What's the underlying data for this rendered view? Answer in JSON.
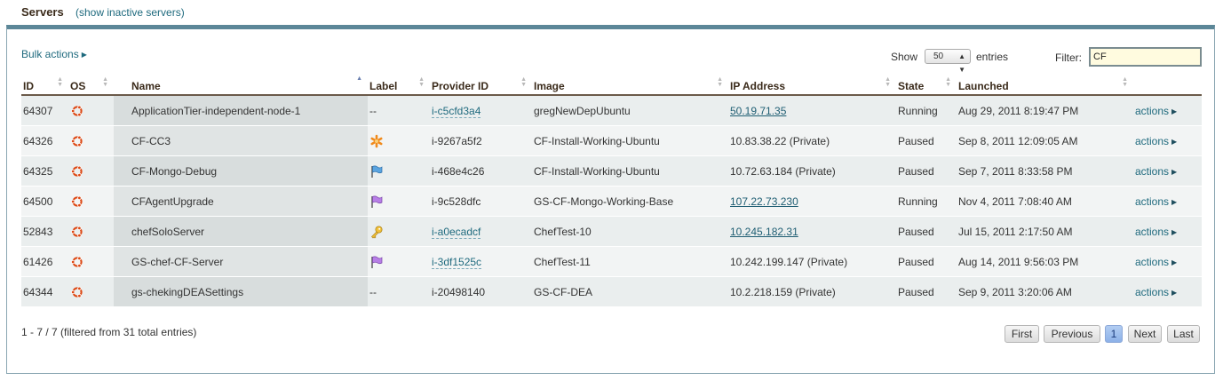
{
  "header": {
    "title": "Servers",
    "inactive_link": "(show inactive servers)"
  },
  "toolbar": {
    "bulk_actions": "Bulk actions",
    "show_label": "Show",
    "show_value": "50",
    "entries_label": "entries",
    "filter_label": "Filter:",
    "filter_value": "CF"
  },
  "table": {
    "columns": [
      "ID",
      "OS",
      "Name",
      "Label",
      "Provider ID",
      "Image",
      "IP Address",
      "State",
      "Launched"
    ],
    "sorted_column": "Name",
    "rows": [
      {
        "id": "64307",
        "os": "ubuntu-icon",
        "name": "ApplicationTier-independent-node-1",
        "label": "--",
        "label_icon": "",
        "provider_id": "i-c5cfd3a4",
        "provider_link": true,
        "image": "gregNewDepUbuntu",
        "ip": "50.19.71.35",
        "ip_link": true,
        "state": "Running",
        "launched": "Aug 29, 2011 8:19:47 PM",
        "actions": "actions"
      },
      {
        "id": "64326",
        "os": "ubuntu-icon",
        "name": "CF-CC3",
        "label": "",
        "label_icon": "orange-star",
        "provider_id": "i-9267a5f2",
        "provider_link": false,
        "image": "CF-Install-Working-Ubuntu",
        "ip": "10.83.38.22 (Private)",
        "ip_link": false,
        "state": "Paused",
        "launched": "Sep 8, 2011 12:09:05 AM",
        "actions": "actions"
      },
      {
        "id": "64325",
        "os": "ubuntu-icon",
        "name": "CF-Mongo-Debug",
        "label": "",
        "label_icon": "blue-flag",
        "provider_id": "i-468e4c26",
        "provider_link": false,
        "image": "CF-Install-Working-Ubuntu",
        "ip": "10.72.63.184 (Private)",
        "ip_link": false,
        "state": "Paused",
        "launched": "Sep 7, 2011 8:33:58 PM",
        "actions": "actions"
      },
      {
        "id": "64500",
        "os": "ubuntu-icon",
        "name": "CFAgentUpgrade",
        "label": "",
        "label_icon": "purple-flag",
        "provider_id": "i-9c528dfc",
        "provider_link": false,
        "image": "GS-CF-Mongo-Working-Base",
        "ip": "107.22.73.230",
        "ip_link": true,
        "state": "Running",
        "launched": "Nov 4, 2011 7:08:40 AM",
        "actions": "actions"
      },
      {
        "id": "52843",
        "os": "ubuntu-icon",
        "name": "chefSoloServer",
        "label": "",
        "label_icon": "key",
        "provider_id": "i-a0ecadcf",
        "provider_link": true,
        "image": "ChefTest-10",
        "ip": "10.245.182.31",
        "ip_link": true,
        "state": "Paused",
        "launched": "Jul 15, 2011 2:17:50 AM",
        "actions": "actions"
      },
      {
        "id": "61426",
        "os": "ubuntu-icon",
        "name": "GS-chef-CF-Server",
        "label": "",
        "label_icon": "purple-flag",
        "provider_id": "i-3df1525c",
        "provider_link": true,
        "image": "ChefTest-11",
        "ip": "10.242.199.147 (Private)",
        "ip_link": false,
        "state": "Paused",
        "launched": "Aug 14, 2011 9:56:03 PM",
        "actions": "actions"
      },
      {
        "id": "64344",
        "os": "ubuntu-icon",
        "name": "gs-chekingDEASettings",
        "label": "--",
        "label_icon": "",
        "provider_id": "i-20498140",
        "provider_link": false,
        "image": "GS-CF-DEA",
        "ip": "10.2.218.159 (Private)",
        "ip_link": false,
        "state": "Paused",
        "launched": "Sep 9, 2011 3:20:06 AM",
        "actions": "actions"
      }
    ]
  },
  "footer": {
    "info": "1 - 7 / 7 (filtered from 31 total entries)",
    "pager": {
      "first": "First",
      "previous": "Previous",
      "current": "1",
      "next": "Next",
      "last": "Last"
    }
  },
  "colors": {
    "link": "#1f6a7e",
    "panel_border": "#5c8798",
    "filter_bg": "#fffbdf"
  }
}
